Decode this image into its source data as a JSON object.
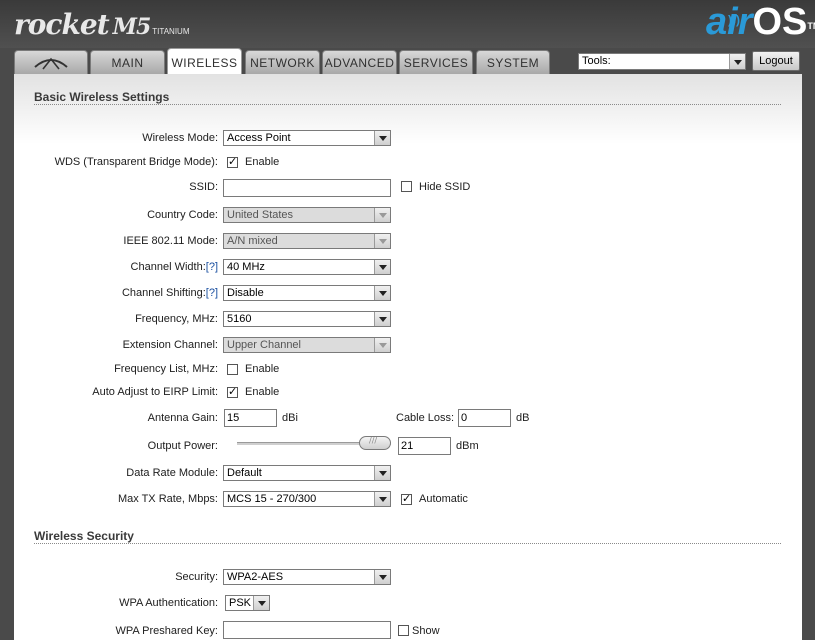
{
  "brand": {
    "product": "rocket",
    "model": "M5",
    "edition": "TITANIUM",
    "os_air": "air",
    "os_os": "OS",
    "tm": "TM"
  },
  "tabs": [
    {
      "id": "home",
      "icon": "ubiquiti-logo-icon"
    },
    {
      "id": "main",
      "label": "MAIN"
    },
    {
      "id": "wireless",
      "label": "WIRELESS",
      "active": true
    },
    {
      "id": "network",
      "label": "NETWORK"
    },
    {
      "id": "advanced",
      "label": "ADVANCED"
    },
    {
      "id": "services",
      "label": "SERVICES"
    },
    {
      "id": "system",
      "label": "SYSTEM"
    }
  ],
  "tools": {
    "value": "Tools:"
  },
  "logout_label": "Logout",
  "basic": {
    "title": "Basic Wireless Settings",
    "wireless_mode": {
      "label": "Wireless Mode:",
      "value": "Access Point"
    },
    "wds": {
      "label": "WDS (Transparent Bridge Mode):",
      "checkbox_label": "Enable",
      "checked": true
    },
    "ssid": {
      "label": "SSID:",
      "value": "",
      "hide_label": "Hide SSID",
      "hide_checked": false
    },
    "country_code": {
      "label": "Country Code:",
      "value": "United States"
    },
    "ieee_mode": {
      "label": "IEEE 802.11 Mode:",
      "value": "A/N mixed"
    },
    "channel_width": {
      "label": "Channel Width:",
      "help": "[?]",
      "value": "40 MHz"
    },
    "channel_shifting": {
      "label": "Channel Shifting:",
      "help": "[?]",
      "value": "Disable"
    },
    "frequency": {
      "label": "Frequency, MHz:",
      "value": "5160"
    },
    "extension_channel": {
      "label": "Extension Channel:",
      "value": "Upper Channel"
    },
    "frequency_list": {
      "label": "Frequency List, MHz:",
      "checkbox_label": "Enable",
      "checked": false
    },
    "auto_adjust": {
      "label": "Auto Adjust to EIRP Limit:",
      "checkbox_label": "Enable",
      "checked": true
    },
    "antenna_gain": {
      "label": "Antenna Gain:",
      "value": "15",
      "unit": "dBi"
    },
    "cable_loss": {
      "label": "Cable Loss:",
      "value": "0",
      "unit": "dB"
    },
    "output_power": {
      "label": "Output Power:",
      "value": "21",
      "unit": "dBm",
      "slider_level": 1.0
    },
    "data_rate_module": {
      "label": "Data Rate Module:",
      "value": "Default"
    },
    "max_tx_rate": {
      "label": "Max TX Rate, Mbps:",
      "value": "MCS 15 - 270/300",
      "auto_label": "Automatic",
      "auto_checked": true
    }
  },
  "security": {
    "title": "Wireless Security",
    "security": {
      "label": "Security:",
      "value": "WPA2-AES"
    },
    "wpa_auth": {
      "label": "WPA Authentication:",
      "value": "PSK"
    },
    "wpa_key": {
      "label": "WPA Preshared Key:",
      "value": "",
      "show_label": "Show",
      "show_checked": false
    }
  }
}
